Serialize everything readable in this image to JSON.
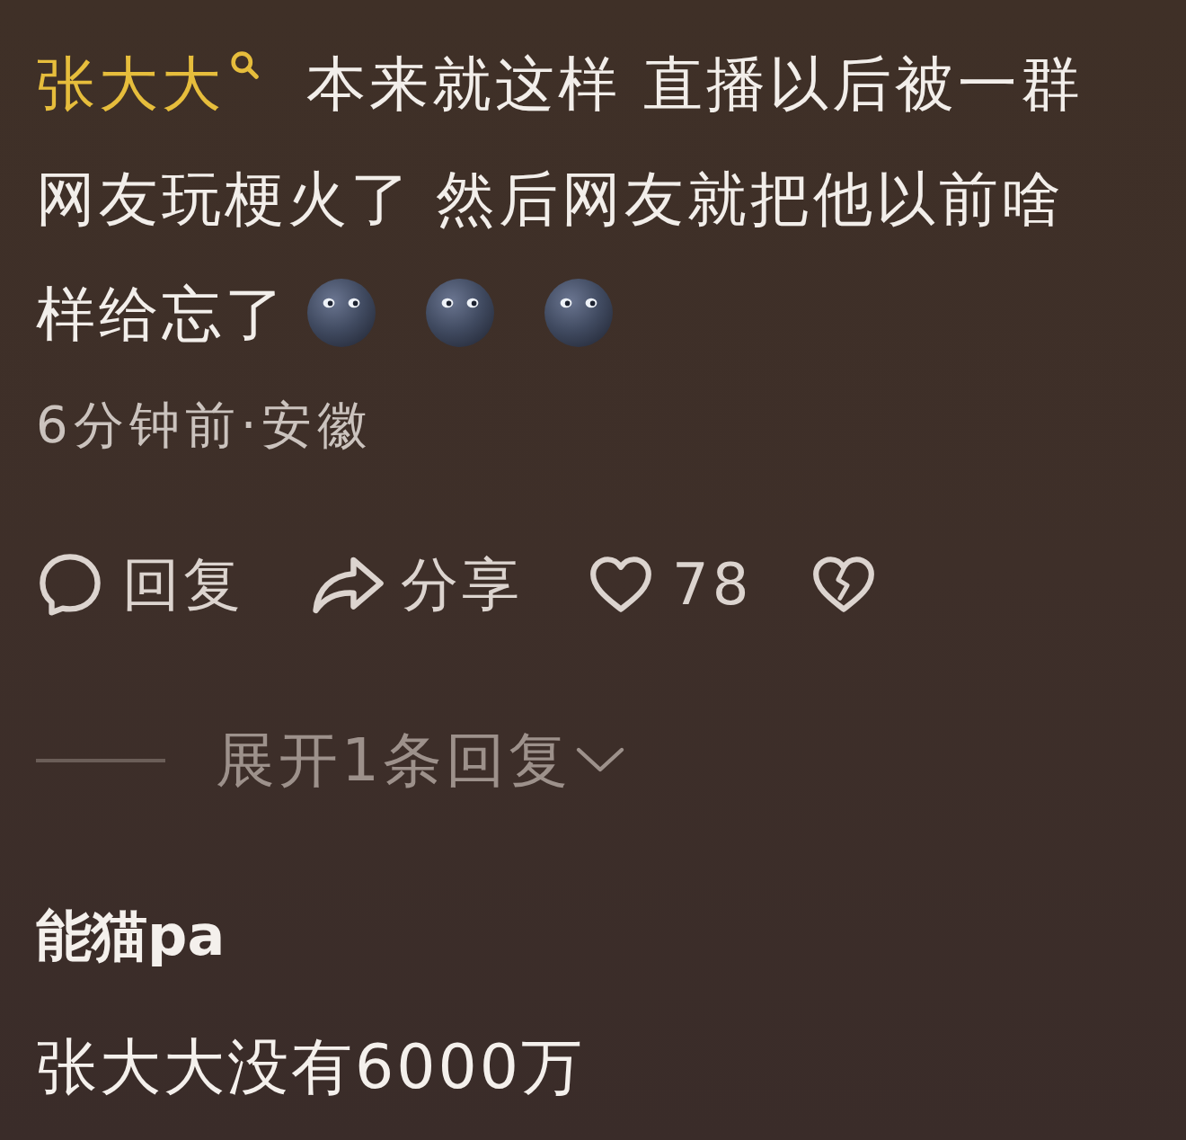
{
  "comment": {
    "keyword": "张大大",
    "text": "本来就这样 直播以后被一群网友玩梗火了 然后网友就把他以前啥样给忘了",
    "time_location": "6分钟前·安徽",
    "actions": {
      "reply": "回复",
      "share": "分享",
      "likes": "78"
    },
    "replies_toggle": "展开1条回复"
  },
  "next_comment": {
    "author": "能猫pa",
    "text": "张大大没有6000万"
  }
}
